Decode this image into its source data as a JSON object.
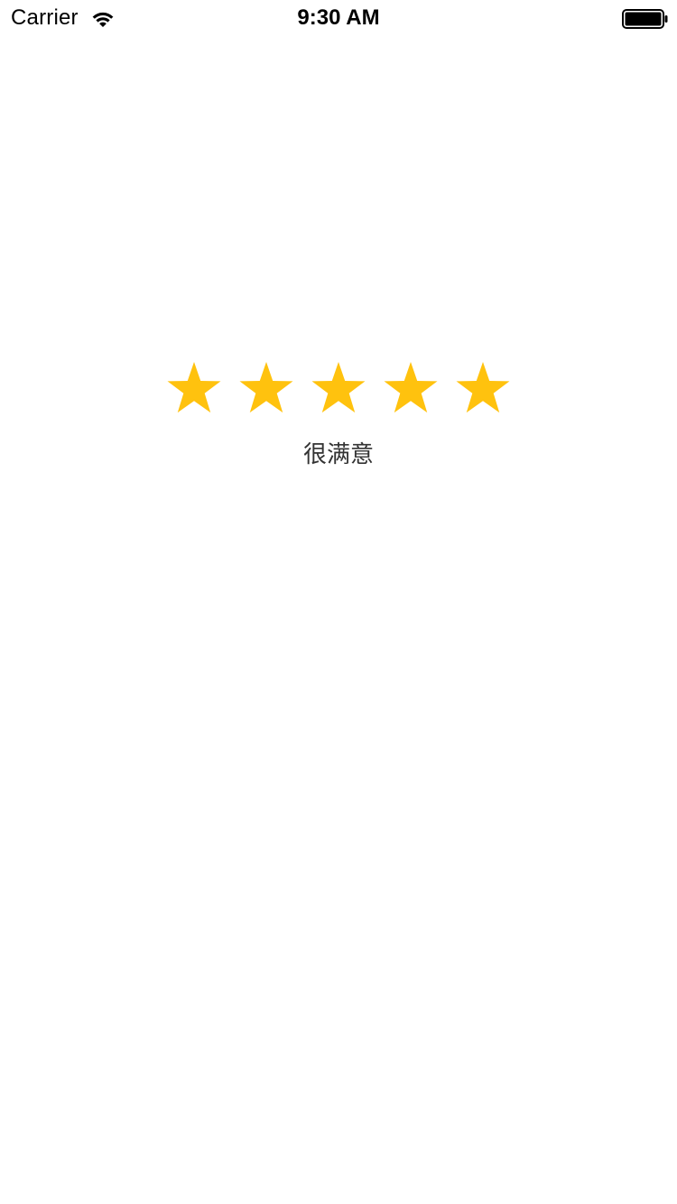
{
  "status_bar": {
    "carrier": "Carrier",
    "time": "9:30 AM",
    "wifi_icon": "wifi-icon",
    "battery_icon": "battery-full-icon"
  },
  "rating": {
    "value": 5,
    "max": 5,
    "label": "很满意",
    "star_icon": "star-icon",
    "star_color": "#FFC20E",
    "label_color": "#333333"
  }
}
